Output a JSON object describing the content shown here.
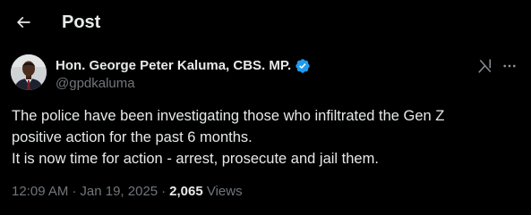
{
  "header": {
    "title": "Post",
    "back_icon": "arrow-left-icon"
  },
  "author": {
    "name": "Hon. George Peter Kaluma, CBS. MP.",
    "handle": "@gpdkaluma",
    "verified_icon": "verified-badge-icon",
    "verified_color": "#1d9bf0"
  },
  "actions": {
    "grok_icon": "grok-icon",
    "more_icon": "more-horizontal-icon"
  },
  "tweet": {
    "lines": [
      "The police have been investigating those who infiltrated the Gen Z",
      "positive action for the past 6 months.",
      "It is now time for action - arrest, prosecute and jail them."
    ]
  },
  "meta": {
    "time": "12:09 AM",
    "separator": "·",
    "date": "Jan 19, 2025",
    "views_count": "2,065",
    "views_label": "Views"
  },
  "colors": {
    "background": "#000000",
    "text_primary": "#e7e9ea",
    "text_secondary": "#71767b",
    "accent": "#1d9bf0"
  }
}
